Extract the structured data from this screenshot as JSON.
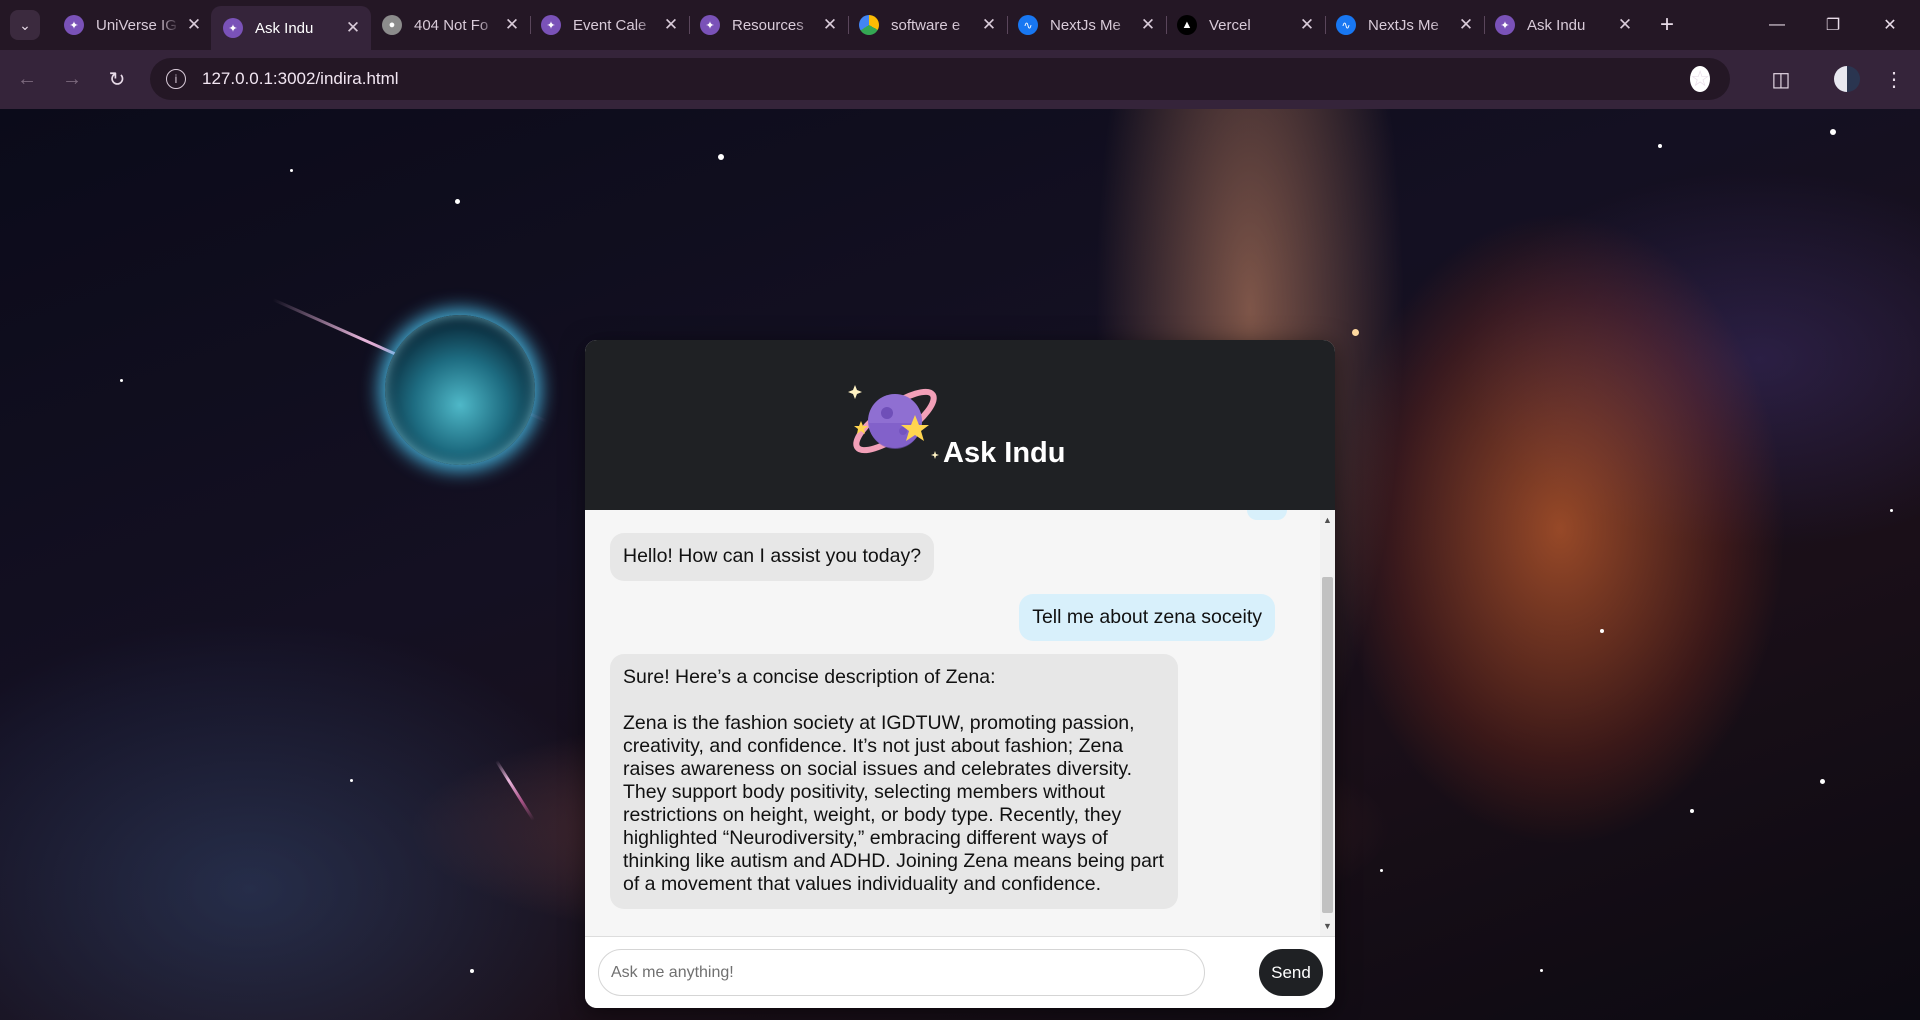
{
  "browser": {
    "tabs": [
      {
        "title": "UniVerse IG",
        "favicon": "planet-favicon",
        "active": false
      },
      {
        "title": "Ask Indu",
        "favicon": "planet-favicon",
        "active": true
      },
      {
        "title": "404 Not Fo",
        "favicon": "globe-favicon",
        "active": false
      },
      {
        "title": "Event Cale",
        "favicon": "planet-favicon",
        "active": false
      },
      {
        "title": "Resources",
        "favicon": "planet-favicon",
        "active": false
      },
      {
        "title": "software e",
        "favicon": "drive-favicon",
        "active": false
      },
      {
        "title": "NextJs Me",
        "favicon": "messenger-favicon",
        "active": false
      },
      {
        "title": "Vercel",
        "favicon": "vercel-favicon",
        "active": false
      },
      {
        "title": "NextJs Me",
        "favicon": "messenger-favicon",
        "active": false
      },
      {
        "title": "Ask Indu",
        "favicon": "planet-favicon",
        "active": false
      }
    ],
    "url": "127.0.0.1:3002/indira.html"
  },
  "chat": {
    "title": "Ask Indu",
    "messages": [
      {
        "role": "bot",
        "text": "Hello! How can I assist you today?"
      },
      {
        "role": "user",
        "text": "Tell me about zena soceity"
      },
      {
        "role": "bot",
        "intro": "Sure! Here’s a concise description of Zena:",
        "body": "Zena is the fashion society at IGDTUW, promoting passion, creativity, and confidence. It’s not just about fashion; Zena raises awareness on social issues and celebrates diversity. They support body positivity, selecting members without restrictions on height, weight, or body type. Recently, they highlighted “Neurodiversity,” embracing different ways of thinking like autism and ADHD. Joining Zena means being part of a movement that values individuality and confidence."
      }
    ],
    "input_placeholder": "Ask me anything!",
    "send_label": "Send"
  },
  "colors": {
    "header_bg": "#1f2124",
    "bot_bubble": "#e7e7e7",
    "user_bubble": "#d8f0fb",
    "browser_frame": "#35243a"
  }
}
